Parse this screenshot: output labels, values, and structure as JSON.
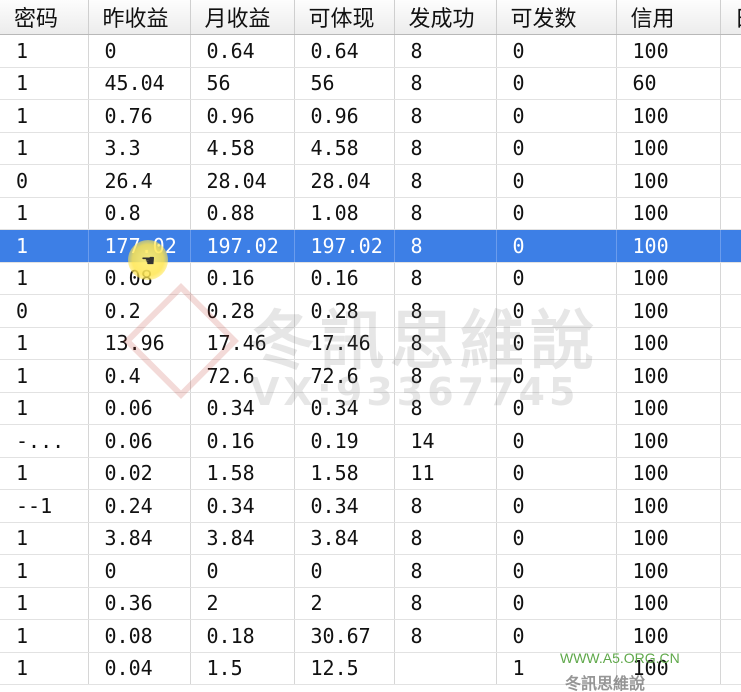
{
  "columns": [
    "密码",
    "昨收益",
    "月收益",
    "可体现",
    "发成功",
    "可发数",
    "信用",
    "日"
  ],
  "rows": [
    [
      "1",
      "0",
      "0.64",
      "0.64",
      "8",
      "0",
      "100"
    ],
    [
      "1",
      "45.04",
      "56",
      "56",
      "8",
      "0",
      "60"
    ],
    [
      "1",
      "0.76",
      "0.96",
      "0.96",
      "8",
      "0",
      "100"
    ],
    [
      "1",
      "3.3",
      "4.58",
      "4.58",
      "8",
      "0",
      "100"
    ],
    [
      "0",
      "26.4",
      "28.04",
      "28.04",
      "8",
      "0",
      "100"
    ],
    [
      "1",
      "0.8",
      "0.88",
      "1.08",
      "8",
      "0",
      "100"
    ],
    [
      "1",
      "177.02",
      "197.02",
      "197.02",
      "8",
      "0",
      "100"
    ],
    [
      "1",
      "0.08",
      "0.16",
      "0.16",
      "8",
      "0",
      "100"
    ],
    [
      "0",
      "0.2",
      "0.28",
      "0.28",
      "8",
      "0",
      "100"
    ],
    [
      "1",
      "13.96",
      "17.46",
      "17.46",
      "8",
      "0",
      "100"
    ],
    [
      "1",
      "0.4",
      "72.6",
      "72.6",
      "8",
      "0",
      "100"
    ],
    [
      "1",
      "0.06",
      "0.34",
      "0.34",
      "8",
      "0",
      "100"
    ],
    [
      "-...",
      "0.06",
      "0.16",
      "0.19",
      "14",
      "0",
      "100"
    ],
    [
      "1",
      "0.02",
      "1.58",
      "1.58",
      "11",
      "0",
      "100"
    ],
    [
      "--1",
      "0.24",
      "0.34",
      "0.34",
      "8",
      "0",
      "100"
    ],
    [
      "1",
      "3.84",
      "3.84",
      "3.84",
      "8",
      "0",
      "100"
    ],
    [
      "1",
      "0",
      "0",
      "0",
      "8",
      "0",
      "100"
    ],
    [
      "1",
      "0.36",
      "2",
      "2",
      "8",
      "0",
      "100"
    ],
    [
      "1",
      "0.08",
      "0.18",
      "30.67",
      "8",
      "0",
      "100"
    ],
    [
      "1",
      "0.04",
      "1.5",
      "12.5",
      "",
      "1",
      "100"
    ]
  ],
  "selected_row_index": 6,
  "colors": {
    "selection": "#3d7fe6",
    "header_bg": "#ececec",
    "grid_line": "#d6d6d6"
  },
  "watermark": {
    "title": "冬訊思維說",
    "subtitle": "VX:93367745"
  },
  "site_watermark": "WWW.A5.ORG.CN",
  "brand_watermark": "冬訊思維說"
}
